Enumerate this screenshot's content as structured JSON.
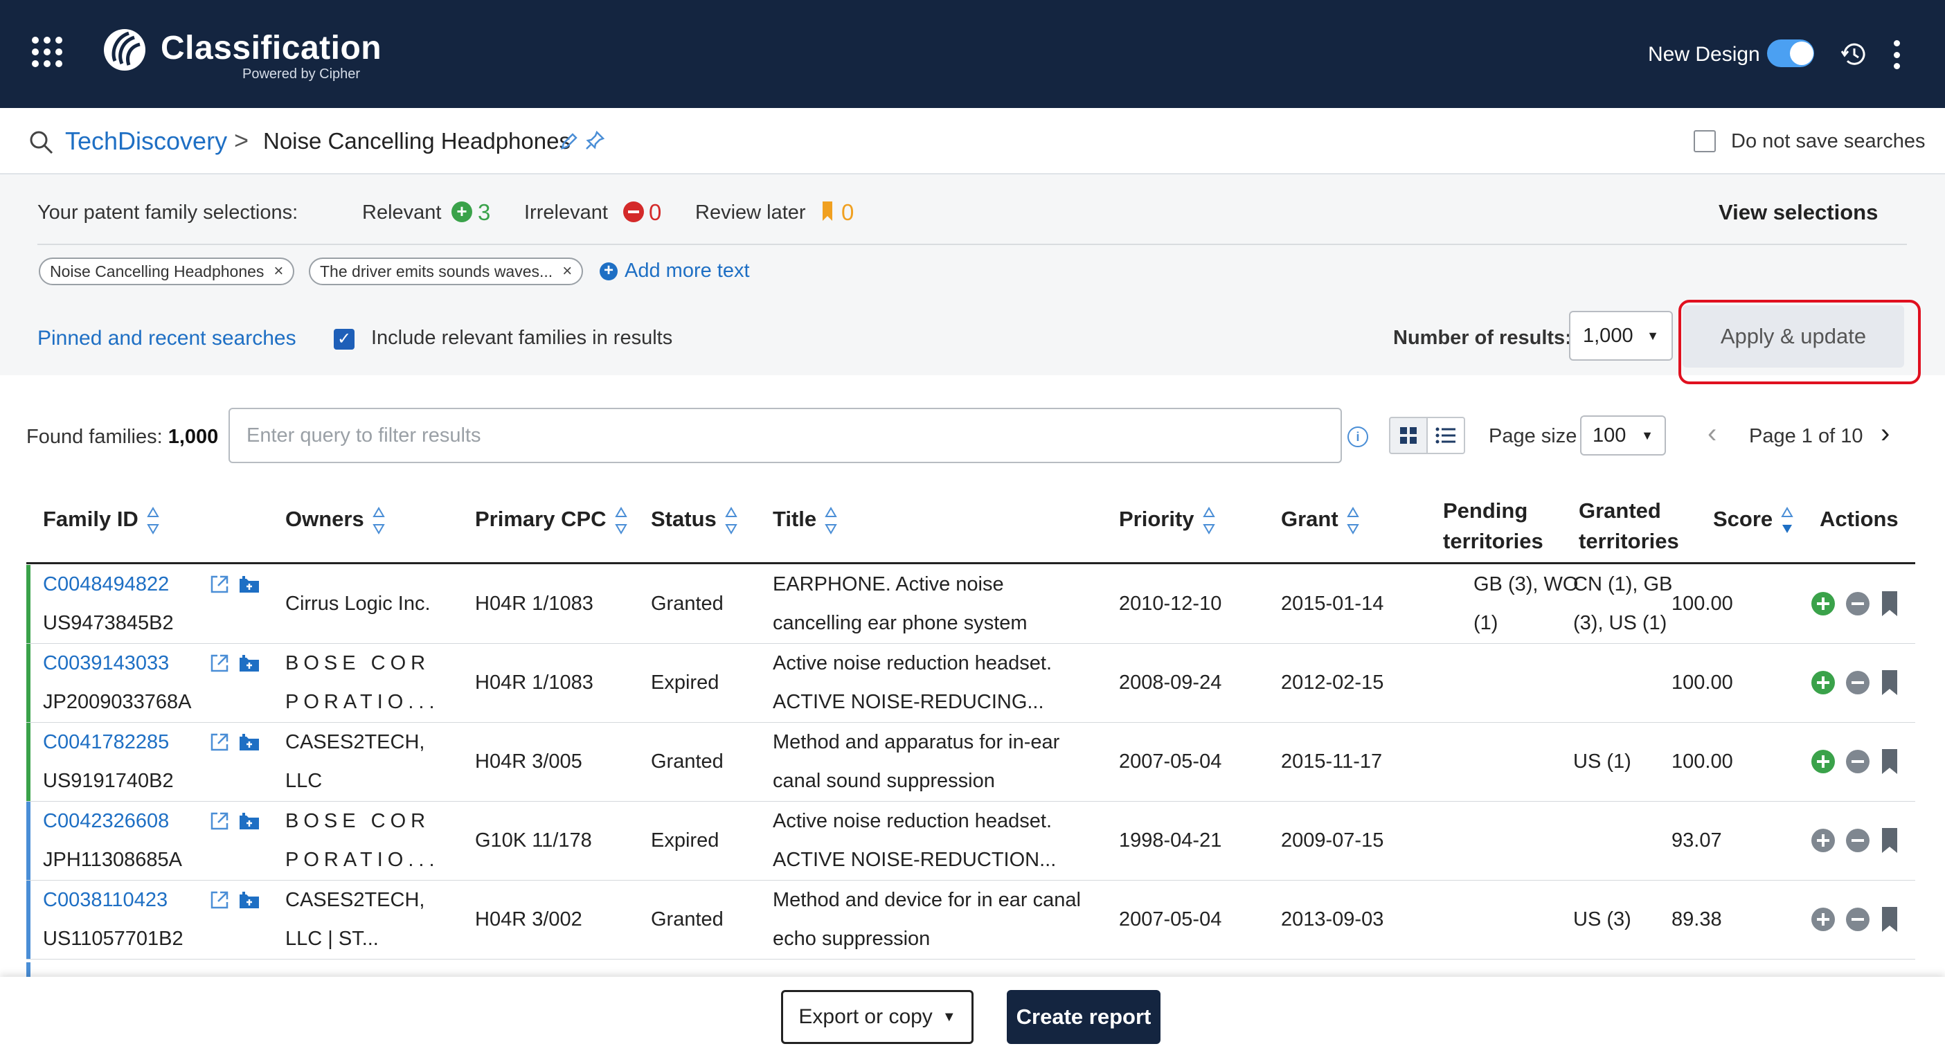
{
  "header": {
    "brand": "Classification",
    "brand_sub": "Powered by Cipher",
    "new_design_label": "New Design",
    "new_design_on": true,
    "colors": {
      "bar": "#142540",
      "toggle": "#4ba0f2"
    }
  },
  "breadcrumb": {
    "root": "TechDiscovery",
    "separator": ">",
    "current": "Noise Cancelling Headphones",
    "do_not_save_label": "Do not save searches"
  },
  "selections": {
    "label": "Your patent family selections:",
    "relevant_label": "Relevant",
    "relevant_count": "3",
    "irrelevant_label": "Irrelevant",
    "irrelevant_count": "0",
    "review_label": "Review later",
    "review_count": "0",
    "view_label": "View selections",
    "chips": [
      "Noise Cancelling Headphones",
      "The driver emits sounds waves..."
    ],
    "chip_remove": "×",
    "add_more": "Add more text",
    "pinned_label": "Pinned and recent searches",
    "include_label": "Include relevant families in results",
    "include_checked": true,
    "num_results_label": "Number of results:",
    "num_results_value": "1,000",
    "apply_label": "Apply & update"
  },
  "results": {
    "found_label": "Found families:",
    "found_count": "1,000",
    "filter_placeholder": "Enter query to filter results",
    "page_size_label": "Page size",
    "page_size_value": "100",
    "page_label": "Page 1 of 10"
  },
  "table": {
    "headers": {
      "family_id": "Family ID",
      "owners": "Owners",
      "cpc": "Primary CPC",
      "status": "Status",
      "title": "Title",
      "priority": "Priority",
      "grant": "Grant",
      "pending_1": "Pending",
      "pending_2": "territories",
      "granted_1": "Granted",
      "granted_2": "territories",
      "score": "Score",
      "actions": "Actions"
    },
    "rows": [
      {
        "id": "C0048494822",
        "pub": "US9473845B2",
        "owner_1": "Cirrus Logic Inc.",
        "owner_2": "",
        "owner_spaced": false,
        "cpc": "H04R 1/1083",
        "status": "Granted",
        "title_1": "EARPHONE. Active noise",
        "title_2": "cancelling ear phone system",
        "priority": "2010-12-10",
        "grant": "2015-01-14",
        "pending_1": "GB (3), WO",
        "pending_2": "(1)",
        "granted_1": "CN (1), GB",
        "granted_2": "(3), US (1)",
        "score": "100.00",
        "relevant": true
      },
      {
        "id": "C0039143033",
        "pub": "JP2009033768A",
        "owner_1": "BOSE COR",
        "owner_2": "PORATIO...",
        "owner_spaced": true,
        "cpc": "H04R 1/1083",
        "status": "Expired",
        "title_1": "Active noise reduction headset.",
        "title_2": "ACTIVE NOISE-REDUCING...",
        "priority": "2008-09-24",
        "grant": "2012-02-15",
        "pending_1": "",
        "pending_2": "",
        "granted_1": "",
        "granted_2": "",
        "score": "100.00",
        "relevant": true
      },
      {
        "id": "C0041782285",
        "pub": "US9191740B2",
        "owner_1": "CASES2TECH,",
        "owner_2": "LLC",
        "owner_spaced": false,
        "cpc": "H04R 3/005",
        "status": "Granted",
        "title_1": "Method and apparatus for in-ear",
        "title_2": "canal sound suppression",
        "priority": "2007-05-04",
        "grant": "2015-11-17",
        "pending_1": "",
        "pending_2": "",
        "granted_1": "US (1)",
        "granted_2": "",
        "score": "100.00",
        "relevant": true
      },
      {
        "id": "C0042326608",
        "pub": "JPH11308685A",
        "owner_1": "BOSE COR",
        "owner_2": "PORATIO...",
        "owner_spaced": true,
        "cpc": "G10K 11/178",
        "status": "Expired",
        "title_1": "Active noise reduction headset.",
        "title_2": "ACTIVE NOISE-REDUCTION...",
        "priority": "1998-04-21",
        "grant": "2009-07-15",
        "pending_1": "",
        "pending_2": "",
        "granted_1": "",
        "granted_2": "",
        "score": "93.07",
        "relevant": false
      },
      {
        "id": "C0038110423",
        "pub": "US11057701B2",
        "owner_1": "CASES2TECH,",
        "owner_2": "LLC | ST...",
        "owner_spaced": false,
        "cpc": "H04R 3/002",
        "status": "Granted",
        "title_1": "Method and device for in ear canal",
        "title_2": "echo suppression",
        "priority": "2007-05-04",
        "grant": "2013-09-03",
        "pending_1": "",
        "pending_2": "",
        "granted_1": "US (3)",
        "granted_2": "",
        "score": "89.38",
        "relevant": false
      }
    ]
  },
  "footer": {
    "export_label": "Export or copy",
    "report_label": "Create report"
  }
}
